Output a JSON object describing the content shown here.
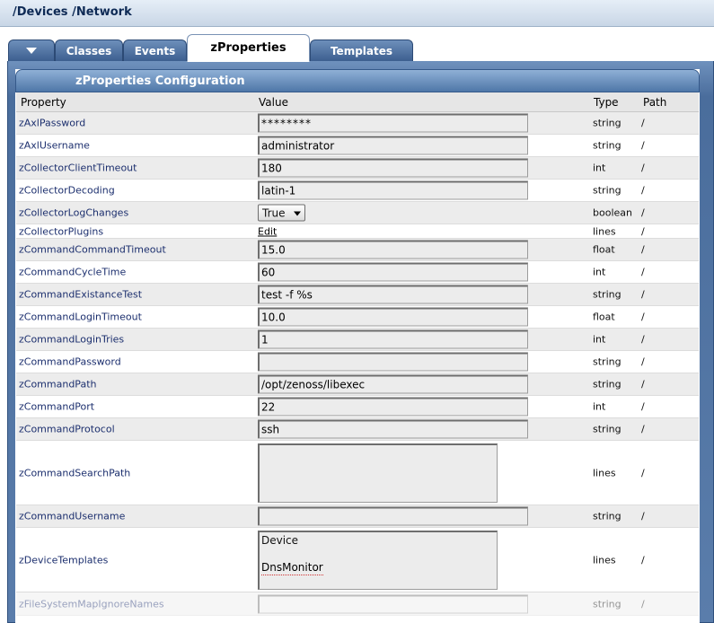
{
  "breadcrumb": "/Devices /Network",
  "tabs": {
    "menu_icon": "triangle-down",
    "items": [
      "Classes",
      "Events",
      "zProperties",
      "Templates"
    ],
    "active": "zProperties"
  },
  "panel": {
    "title": "zProperties Configuration",
    "columns": {
      "property": "Property",
      "value": "Value",
      "type": "Type",
      "path": "Path"
    }
  },
  "rows": [
    {
      "property": "zAxlPassword",
      "value": "********",
      "type": "string",
      "path": "/",
      "widget": "password"
    },
    {
      "property": "zAxlUsername",
      "value": "administrator",
      "type": "string",
      "path": "/",
      "widget": "text"
    },
    {
      "property": "zCollectorClientTimeout",
      "value": "180",
      "type": "int",
      "path": "/",
      "widget": "text"
    },
    {
      "property": "zCollectorDecoding",
      "value": "latin-1",
      "type": "string",
      "path": "/",
      "widget": "text"
    },
    {
      "property": "zCollectorLogChanges",
      "value": "True",
      "type": "boolean",
      "path": "/",
      "widget": "select"
    },
    {
      "property": "zCollectorPlugins",
      "value": "Edit",
      "type": "lines",
      "path": "/",
      "widget": "link"
    },
    {
      "property": "zCommandCommandTimeout",
      "value": "15.0",
      "type": "float",
      "path": "/",
      "widget": "text"
    },
    {
      "property": "zCommandCycleTime",
      "value": "60",
      "type": "int",
      "path": "/",
      "widget": "text"
    },
    {
      "property": "zCommandExistanceTest",
      "value": "test -f %s",
      "type": "string",
      "path": "/",
      "widget": "text"
    },
    {
      "property": "zCommandLoginTimeout",
      "value": "10.0",
      "type": "float",
      "path": "/",
      "widget": "text"
    },
    {
      "property": "zCommandLoginTries",
      "value": "1",
      "type": "int",
      "path": "/",
      "widget": "text"
    },
    {
      "property": "zCommandPassword",
      "value": "",
      "type": "string",
      "path": "/",
      "widget": "text"
    },
    {
      "property": "zCommandPath",
      "value": "/opt/zenoss/libexec",
      "type": "string",
      "path": "/",
      "widget": "text"
    },
    {
      "property": "zCommandPort",
      "value": "22",
      "type": "int",
      "path": "/",
      "widget": "text"
    },
    {
      "property": "zCommandProtocol",
      "value": "ssh",
      "type": "string",
      "path": "/",
      "widget": "text"
    },
    {
      "property": "zCommandSearchPath",
      "value": "",
      "type": "lines",
      "path": "/",
      "widget": "textarea"
    },
    {
      "property": "zCommandUsername",
      "value": "",
      "type": "string",
      "path": "/",
      "widget": "text"
    },
    {
      "property": "zDeviceTemplates",
      "lines": [
        "Device",
        "DnsMonitor"
      ],
      "type": "lines",
      "path": "/",
      "widget": "textarea"
    },
    {
      "property": "zFileSystemMapIgnoreNames",
      "value": "",
      "type": "string",
      "path": "/",
      "widget": "text"
    }
  ]
}
